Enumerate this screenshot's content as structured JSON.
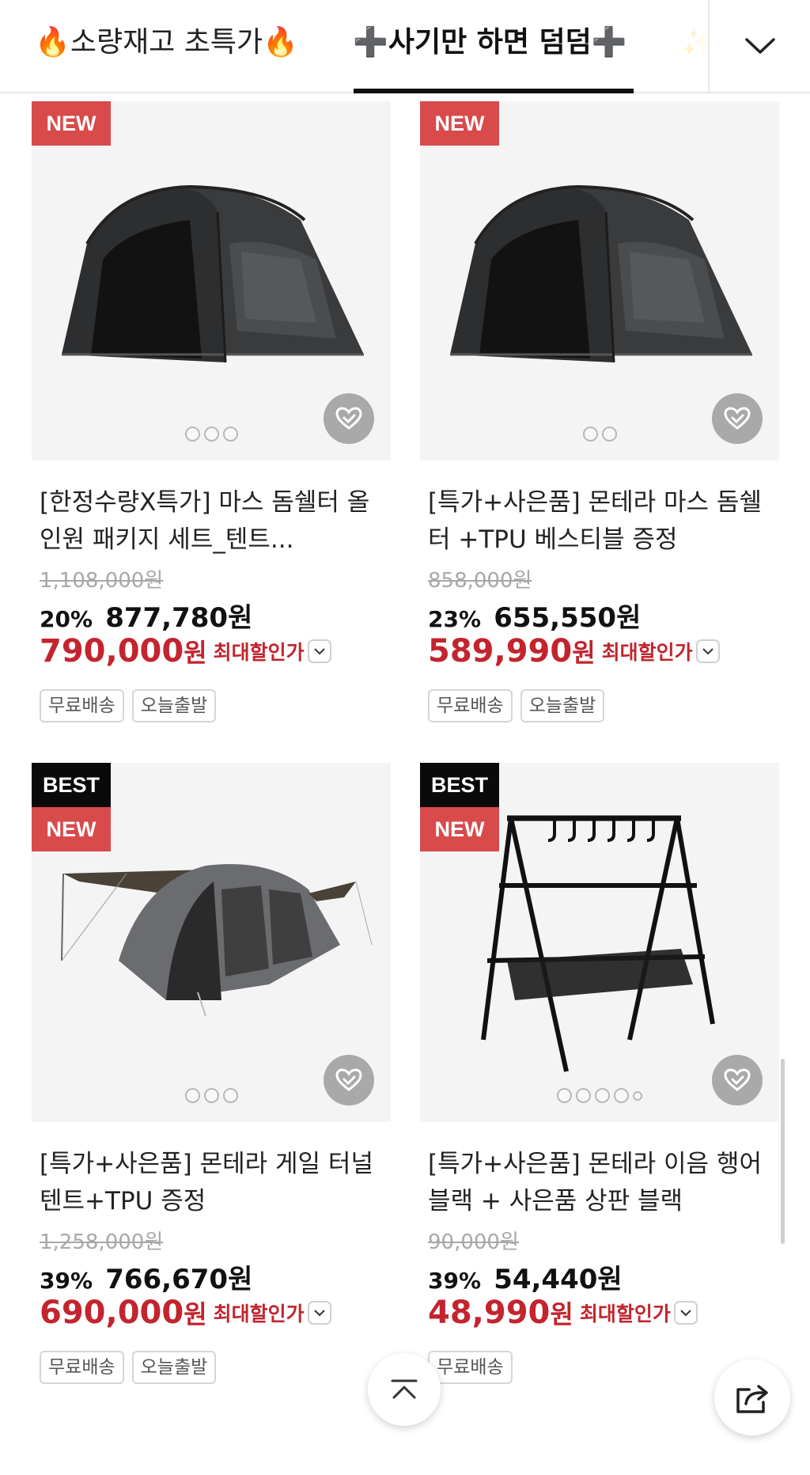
{
  "tabs": [
    {
      "label": "🔥소량재고 초특가🔥"
    },
    {
      "label": "➕사기만 하면 덤덤➕"
    },
    {
      "label": "✨"
    }
  ],
  "products": [
    {
      "badges": [
        "NEW"
      ],
      "image_dots": 3,
      "title": "[한정수량X특가] 마스 돔쉘터 올인원 패키지 세트_텐트...",
      "original_price": "1,108,000원",
      "discount_percent": "20%",
      "sale_price": "877,780원",
      "max_discount_amount": "790,000",
      "currency": "원",
      "max_discount_label": "최대할인가",
      "tags": [
        "무료배송",
        "오늘출발"
      ]
    },
    {
      "badges": [
        "NEW"
      ],
      "image_dots": 2,
      "title": "[특가+사은품] 몬테라 마스 돔쉘터 +TPU 베스티블 증정",
      "original_price": "858,000원",
      "discount_percent": "23%",
      "sale_price": "655,550원",
      "max_discount_amount": "589,990",
      "currency": "원",
      "max_discount_label": "최대할인가",
      "tags": [
        "무료배송",
        "오늘출발"
      ]
    },
    {
      "badges": [
        "BEST",
        "NEW"
      ],
      "image_dots": 3,
      "title": "[특가+사은품] 몬테라 게일 터널텐트+TPU 증정",
      "original_price": "1,258,000원",
      "discount_percent": "39%",
      "sale_price": "766,670원",
      "max_discount_amount": "690,000",
      "currency": "원",
      "max_discount_label": "최대할인가",
      "tags": [
        "무료배송",
        "오늘출발"
      ]
    },
    {
      "badges": [
        "BEST",
        "NEW"
      ],
      "image_dots": 5,
      "title": "[특가+사은품] 몬테라 이음 행어 블랙 + 사은품 상판 블랙",
      "original_price": "90,000원",
      "discount_percent": "39%",
      "sale_price": "54,440원",
      "max_discount_amount": "48,990",
      "currency": "원",
      "max_discount_label": "최대할인가",
      "tags": [
        "무료배송"
      ]
    }
  ],
  "colors": {
    "accent_red": "#c3242e",
    "badge_new": "#d94a4b",
    "badge_best": "#0a0a0a"
  },
  "icons": {
    "tab_toggle": "chevron-down-icon",
    "wishlist": "heart-check-icon",
    "scroll_top": "arrow-up-bar-icon",
    "share": "share-icon"
  }
}
